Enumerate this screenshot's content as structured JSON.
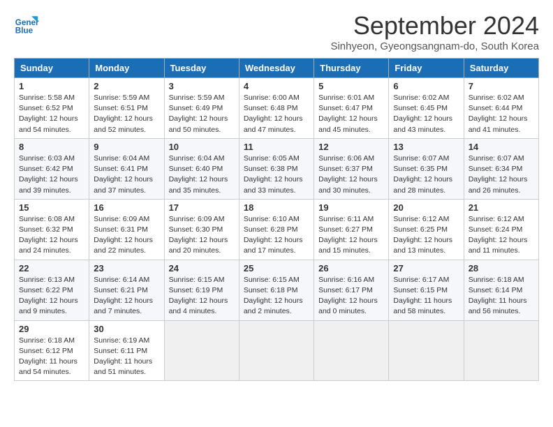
{
  "header": {
    "logo_line1": "General",
    "logo_line2": "Blue",
    "title": "September 2024",
    "location": "Sinhyeon, Gyeongsangnam-do, South Korea"
  },
  "weekdays": [
    "Sunday",
    "Monday",
    "Tuesday",
    "Wednesday",
    "Thursday",
    "Friday",
    "Saturday"
  ],
  "weeks": [
    [
      {
        "day": "1",
        "lines": [
          "Sunrise: 5:58 AM",
          "Sunset: 6:52 PM",
          "Daylight: 12 hours",
          "and 54 minutes."
        ]
      },
      {
        "day": "2",
        "lines": [
          "Sunrise: 5:59 AM",
          "Sunset: 6:51 PM",
          "Daylight: 12 hours",
          "and 52 minutes."
        ]
      },
      {
        "day": "3",
        "lines": [
          "Sunrise: 5:59 AM",
          "Sunset: 6:49 PM",
          "Daylight: 12 hours",
          "and 50 minutes."
        ]
      },
      {
        "day": "4",
        "lines": [
          "Sunrise: 6:00 AM",
          "Sunset: 6:48 PM",
          "Daylight: 12 hours",
          "and 47 minutes."
        ]
      },
      {
        "day": "5",
        "lines": [
          "Sunrise: 6:01 AM",
          "Sunset: 6:47 PM",
          "Daylight: 12 hours",
          "and 45 minutes."
        ]
      },
      {
        "day": "6",
        "lines": [
          "Sunrise: 6:02 AM",
          "Sunset: 6:45 PM",
          "Daylight: 12 hours",
          "and 43 minutes."
        ]
      },
      {
        "day": "7",
        "lines": [
          "Sunrise: 6:02 AM",
          "Sunset: 6:44 PM",
          "Daylight: 12 hours",
          "and 41 minutes."
        ]
      }
    ],
    [
      {
        "day": "8",
        "lines": [
          "Sunrise: 6:03 AM",
          "Sunset: 6:42 PM",
          "Daylight: 12 hours",
          "and 39 minutes."
        ]
      },
      {
        "day": "9",
        "lines": [
          "Sunrise: 6:04 AM",
          "Sunset: 6:41 PM",
          "Daylight: 12 hours",
          "and 37 minutes."
        ]
      },
      {
        "day": "10",
        "lines": [
          "Sunrise: 6:04 AM",
          "Sunset: 6:40 PM",
          "Daylight: 12 hours",
          "and 35 minutes."
        ]
      },
      {
        "day": "11",
        "lines": [
          "Sunrise: 6:05 AM",
          "Sunset: 6:38 PM",
          "Daylight: 12 hours",
          "and 33 minutes."
        ]
      },
      {
        "day": "12",
        "lines": [
          "Sunrise: 6:06 AM",
          "Sunset: 6:37 PM",
          "Daylight: 12 hours",
          "and 30 minutes."
        ]
      },
      {
        "day": "13",
        "lines": [
          "Sunrise: 6:07 AM",
          "Sunset: 6:35 PM",
          "Daylight: 12 hours",
          "and 28 minutes."
        ]
      },
      {
        "day": "14",
        "lines": [
          "Sunrise: 6:07 AM",
          "Sunset: 6:34 PM",
          "Daylight: 12 hours",
          "and 26 minutes."
        ]
      }
    ],
    [
      {
        "day": "15",
        "lines": [
          "Sunrise: 6:08 AM",
          "Sunset: 6:32 PM",
          "Daylight: 12 hours",
          "and 24 minutes."
        ]
      },
      {
        "day": "16",
        "lines": [
          "Sunrise: 6:09 AM",
          "Sunset: 6:31 PM",
          "Daylight: 12 hours",
          "and 22 minutes."
        ]
      },
      {
        "day": "17",
        "lines": [
          "Sunrise: 6:09 AM",
          "Sunset: 6:30 PM",
          "Daylight: 12 hours",
          "and 20 minutes."
        ]
      },
      {
        "day": "18",
        "lines": [
          "Sunrise: 6:10 AM",
          "Sunset: 6:28 PM",
          "Daylight: 12 hours",
          "and 17 minutes."
        ]
      },
      {
        "day": "19",
        "lines": [
          "Sunrise: 6:11 AM",
          "Sunset: 6:27 PM",
          "Daylight: 12 hours",
          "and 15 minutes."
        ]
      },
      {
        "day": "20",
        "lines": [
          "Sunrise: 6:12 AM",
          "Sunset: 6:25 PM",
          "Daylight: 12 hours",
          "and 13 minutes."
        ]
      },
      {
        "day": "21",
        "lines": [
          "Sunrise: 6:12 AM",
          "Sunset: 6:24 PM",
          "Daylight: 12 hours",
          "and 11 minutes."
        ]
      }
    ],
    [
      {
        "day": "22",
        "lines": [
          "Sunrise: 6:13 AM",
          "Sunset: 6:22 PM",
          "Daylight: 12 hours",
          "and 9 minutes."
        ]
      },
      {
        "day": "23",
        "lines": [
          "Sunrise: 6:14 AM",
          "Sunset: 6:21 PM",
          "Daylight: 12 hours",
          "and 7 minutes."
        ]
      },
      {
        "day": "24",
        "lines": [
          "Sunrise: 6:15 AM",
          "Sunset: 6:19 PM",
          "Daylight: 12 hours",
          "and 4 minutes."
        ]
      },
      {
        "day": "25",
        "lines": [
          "Sunrise: 6:15 AM",
          "Sunset: 6:18 PM",
          "Daylight: 12 hours",
          "and 2 minutes."
        ]
      },
      {
        "day": "26",
        "lines": [
          "Sunrise: 6:16 AM",
          "Sunset: 6:17 PM",
          "Daylight: 12 hours",
          "and 0 minutes."
        ]
      },
      {
        "day": "27",
        "lines": [
          "Sunrise: 6:17 AM",
          "Sunset: 6:15 PM",
          "Daylight: 11 hours",
          "and 58 minutes."
        ]
      },
      {
        "day": "28",
        "lines": [
          "Sunrise: 6:18 AM",
          "Sunset: 6:14 PM",
          "Daylight: 11 hours",
          "and 56 minutes."
        ]
      }
    ],
    [
      {
        "day": "29",
        "lines": [
          "Sunrise: 6:18 AM",
          "Sunset: 6:12 PM",
          "Daylight: 11 hours",
          "and 54 minutes."
        ]
      },
      {
        "day": "30",
        "lines": [
          "Sunrise: 6:19 AM",
          "Sunset: 6:11 PM",
          "Daylight: 11 hours",
          "and 51 minutes."
        ]
      },
      {
        "day": "",
        "lines": []
      },
      {
        "day": "",
        "lines": []
      },
      {
        "day": "",
        "lines": []
      },
      {
        "day": "",
        "lines": []
      },
      {
        "day": "",
        "lines": []
      }
    ]
  ]
}
